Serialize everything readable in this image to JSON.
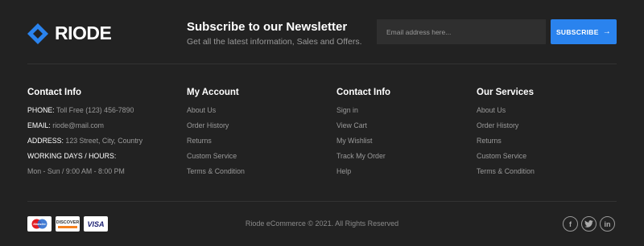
{
  "brand": {
    "name": "RIODE",
    "accent": "#2a83ee"
  },
  "newsletter": {
    "title": "Subscribe to our Newsletter",
    "subtitle": "Get all the latest information, Sales and Offers.",
    "email_placeholder": "Email address here...",
    "subscribe_label": "SUBSCRIBE",
    "arrow": "→"
  },
  "contact": {
    "title": "Contact Info",
    "phone_label": "PHONE:",
    "phone_value": " Toll Free (123) 456-7890",
    "email_label": "EMAIL:",
    "email_value": " riode@mail.com",
    "address_label": "ADDRESS:",
    "address_value": " 123 Street, City, Country",
    "hours_label": "WORKING DAYS / HOURS:",
    "hours_value": "Mon - Sun / 9:00 AM - 8:00 PM"
  },
  "account": {
    "title": "My Account",
    "items": [
      "About Us",
      "Order History",
      "Returns",
      "Custom Service",
      "Terms & Condition"
    ]
  },
  "contact2": {
    "title": "Contact Info",
    "items": [
      "Sign in",
      "View Cart",
      "My Wishlist",
      "Track My Order",
      "Help"
    ]
  },
  "services": {
    "title": "Our Services",
    "items": [
      "About Us",
      "Order History",
      "Returns",
      "Custom Service",
      "Terms & Condition"
    ]
  },
  "payments": {
    "maestro": "Maestro",
    "discover": "DISCOVER",
    "visa": "VISA"
  },
  "copyright": "Riode eCommerce © 2021. All Rights Reserved",
  "social": {
    "facebook": "f",
    "twitter": "t",
    "linkedin": "in"
  }
}
